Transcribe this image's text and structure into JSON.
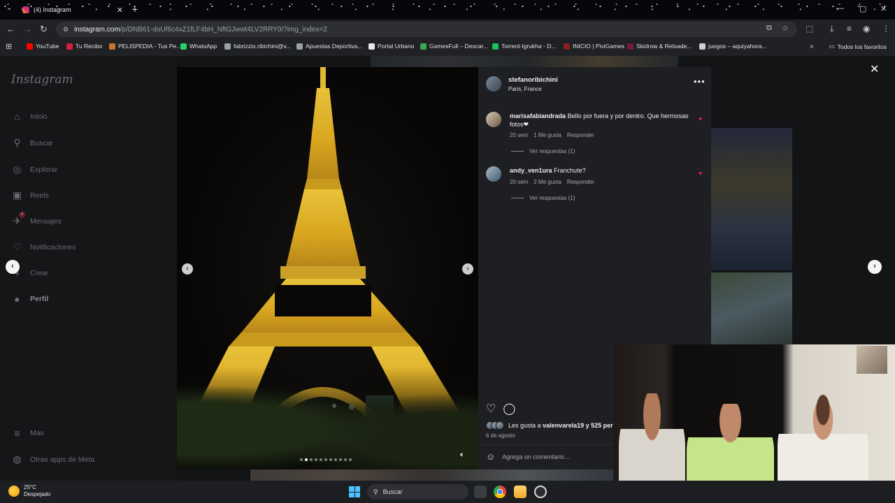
{
  "browser": {
    "tab_title": "(4) Instagram",
    "url_host": "instagram.com",
    "url_path": "/p/DNB61-doUf6c4xZ1fLF4bH_NftGJwwt4LV2RRY0/?img_index=2",
    "bookmarks": [
      {
        "label": "YouTube",
        "color": "#ff0000"
      },
      {
        "label": "Tu Recibo",
        "color": "#d21f3c"
      },
      {
        "label": "PELISPEDIA - Tus Pe...",
        "color": "#c0792a"
      },
      {
        "label": "WhatsApp",
        "color": "#25d366"
      },
      {
        "label": "fabrizzio.ribichini@v...",
        "color": "#9aa0a6"
      },
      {
        "label": "Apuestas Deportiva...",
        "color": "#9aa0a6"
      },
      {
        "label": "Portal Urbano",
        "color": "#e8e8e8"
      },
      {
        "label": "GamesFull – Descar...",
        "color": "#3aa757"
      },
      {
        "label": "Torrent-Igrukha - D...",
        "color": "#19c25b"
      },
      {
        "label": "INICIO | PiviGames",
        "color": "#8b1e1e"
      },
      {
        "label": "Skidrow & Reloade...",
        "color": "#7a1a3a"
      },
      {
        "label": "juegos – aquiyahora...",
        "color": "#cfcfcf"
      }
    ],
    "all_bookmarks": "Todos los favoritos"
  },
  "sidebar": {
    "logo": "Instagram",
    "items": [
      {
        "label": "Inicio",
        "icon": "⌂"
      },
      {
        "label": "Buscar",
        "icon": "⚲"
      },
      {
        "label": "Explorar",
        "icon": "◎"
      },
      {
        "label": "Reels",
        "icon": "▣"
      },
      {
        "label": "Mensajes",
        "icon": "✈"
      },
      {
        "label": "Notificaciones",
        "icon": "♡"
      },
      {
        "label": "Crear",
        "icon": "+"
      },
      {
        "label": "Perfil",
        "icon": "●"
      }
    ],
    "messages_badge": "4",
    "more": {
      "label": "Más",
      "icon": "≡"
    },
    "meta": {
      "label": "Otras apps de Meta",
      "icon": "◍"
    }
  },
  "post": {
    "username": "stefanoribichini",
    "location": "Paris, France",
    "comments": [
      {
        "user": "marisafabiandrada",
        "text": "Bello por fuera y por dentro. Que hermosas fotos❤",
        "time": "20 sem",
        "likes": "1 Me gusta",
        "reply": "Responder",
        "replies": "Ver respuestas (1)"
      },
      {
        "user": "andy_ven1ura",
        "text": "Franchute?",
        "time": "20 sem",
        "likes": "2 Me gusta",
        "reply": "Responder",
        "replies": "Ver respuestas (1)"
      }
    ],
    "likes_prefix": "Les gusta a ",
    "likes_user": "valenvarela19",
    "likes_suffix": " y 525 per",
    "date": "6 de agosto",
    "add_comment_placeholder": "Agrega un comentario...",
    "carousel_count": 11,
    "carousel_active": 1
  },
  "taskbar": {
    "temp": "25°C",
    "condition": "Despejado",
    "search": "Buscar"
  },
  "colors": {
    "like_red": "#ed1c45",
    "instagram_panel": "#1e1f22",
    "start_blue": "#4cc2ff"
  }
}
